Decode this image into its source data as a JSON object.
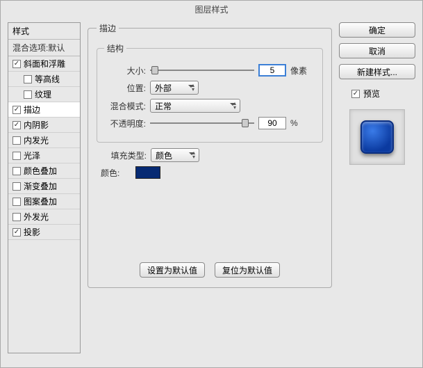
{
  "dialog": {
    "title": "图层样式"
  },
  "styles": {
    "header": "样式",
    "blend_options": "混合选项:默认",
    "items": [
      "斜面和浮雕",
      "等高线",
      "纹理",
      "描边",
      "内阴影",
      "内发光",
      "光泽",
      "颜色叠加",
      "渐变叠加",
      "图案叠加",
      "外发光",
      "投影"
    ],
    "checked": [
      true,
      false,
      false,
      true,
      true,
      false,
      false,
      false,
      false,
      false,
      false,
      true
    ],
    "selected_index": 3
  },
  "stroke": {
    "title": "描边",
    "structure_title": "结构",
    "size_label": "大小:",
    "size_value": "5",
    "size_unit": "像素",
    "position_label": "位置:",
    "position_value": "外部",
    "blend_mode_label": "混合模式:",
    "blend_mode_value": "正常",
    "opacity_label": "不透明度:",
    "opacity_value": "90",
    "opacity_unit": "%",
    "fill_type_label": "填充类型:",
    "fill_type_value": "颜色",
    "color_label": "颜色:",
    "color_hex": "#062a73",
    "make_default": "设置为默认值",
    "reset_default": "复位为默认值"
  },
  "buttons": {
    "ok": "确定",
    "cancel": "取消",
    "new_style": "新建样式...",
    "preview": "预览"
  }
}
